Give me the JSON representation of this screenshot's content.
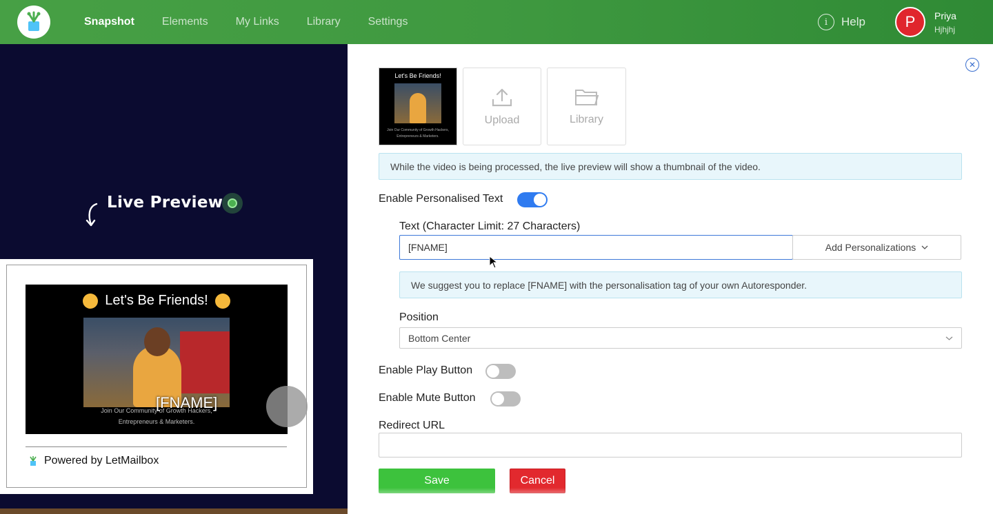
{
  "nav": {
    "items": [
      "Snapshot",
      "Elements",
      "My Links",
      "Library",
      "Settings"
    ],
    "active_index": 0,
    "help_label": "Help",
    "help_icon": "info-icon"
  },
  "user": {
    "avatar_letter": "P",
    "name": "Priya",
    "subtitle": "Hjhjhj"
  },
  "preview": {
    "live_label": "Live Preview",
    "video_title": "Let's Be Friends!",
    "video_caption_line1": "Join Our Community of Growth Hackers,",
    "video_caption_line2": "Entrepreneurs & Marketers.",
    "personalized_overlay": "[FNAME]",
    "powered_by": "Powered by LetMailbox"
  },
  "media": {
    "thumb_title": "Let's Be Friends!",
    "thumb_caption_line1": "Join Our Community of Growth Hackers,",
    "thumb_caption_line2": "Entrepreneurs & Marketers.",
    "upload_label": "Upload",
    "library_label": "Library",
    "processing_note": "While the video is being processed, the live preview will show a thumbnail of the video."
  },
  "personalised_text": {
    "label": "Enable Personalised Text",
    "enabled": true,
    "text_label": "Text (Character Limit: 27 Characters)",
    "text_value": "[FNAME]",
    "add_personalizations_label": "Add Personalizations",
    "suggestion": "We suggest you to replace [FNAME] with the personalisation tag of your own Autoresponder.",
    "position_label": "Position",
    "position_value": "Bottom Center"
  },
  "play_button": {
    "label": "Enable Play Button",
    "enabled": false
  },
  "mute_button": {
    "label": "Enable Mute Button",
    "enabled": false
  },
  "redirect": {
    "label": "Redirect URL",
    "value": ""
  },
  "actions": {
    "save_label": "Save",
    "cancel_label": "Cancel"
  },
  "colors": {
    "nav_green": "#47a045",
    "toggle_on": "#2f7bf0",
    "save_green": "#3dc23d",
    "cancel_red": "#e2292e",
    "avatar_red": "#e0262d"
  }
}
